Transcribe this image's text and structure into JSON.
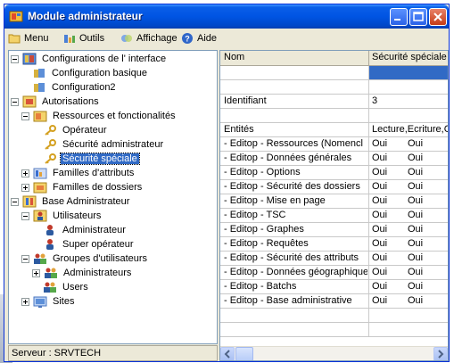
{
  "window": {
    "title": "Module administrateur"
  },
  "menu": [
    {
      "label": "Menu",
      "icon": "folder-icon"
    },
    {
      "label": "Outils",
      "icon": "tools-icon"
    },
    {
      "label": "Affichage",
      "icon": "display-icon"
    },
    {
      "label": "Aide",
      "icon": "help-icon"
    }
  ],
  "tree": [
    {
      "label": "Configurations de l' interface"
    },
    {
      "label": "Configuration basique"
    },
    {
      "label": "Configuration2"
    },
    {
      "label": "Autorisations"
    },
    {
      "label": "Ressources et fonctionalités"
    },
    {
      "label": "Opérateur"
    },
    {
      "label": "Sécurité administrateur"
    },
    {
      "label": "Sécurité spéciale"
    },
    {
      "label": "Familles d'attributs"
    },
    {
      "label": "Familles de dossiers"
    },
    {
      "label": "Base Administrateur"
    },
    {
      "label": "Utilisateurs"
    },
    {
      "label": "Administrateur"
    },
    {
      "label": "Super opérateur"
    },
    {
      "label": "Groupes d'utilisateurs"
    },
    {
      "label": "Administrateurs"
    },
    {
      "label": "Users"
    },
    {
      "label": "Sites"
    }
  ],
  "status": {
    "text": "Serveur : SRVTECH"
  },
  "grid": {
    "columns": [
      "Nom",
      "Sécurité spéciale"
    ],
    "rows": [
      {
        "c1": "",
        "c2": "",
        "c3": ""
      },
      {
        "c1": "Identifiant",
        "c2": "3",
        "c3": ""
      },
      {
        "c1": "",
        "c2": "",
        "c3": ""
      },
      {
        "c1": "Entités",
        "c2": "Lecture,Ecriture,Cr",
        "c3": ""
      },
      {
        "c1": " - Editop - Ressources (Nomencl",
        "c2": "Oui",
        "c3": "Oui"
      },
      {
        "c1": " - Editop - Données générales",
        "c2": "Oui",
        "c3": "Oui"
      },
      {
        "c1": " - Editop - Options",
        "c2": "Oui",
        "c3": "Oui"
      },
      {
        "c1": " - Editop - Sécurité des dossiers",
        "c2": "Oui",
        "c3": "Oui"
      },
      {
        "c1": " - Editop - Mise en page",
        "c2": "Oui",
        "c3": "Oui"
      },
      {
        "c1": " - Editop - TSC",
        "c2": "Oui",
        "c3": "Oui"
      },
      {
        "c1": " - Editop - Graphes",
        "c2": "Oui",
        "c3": "Oui"
      },
      {
        "c1": " - Editop - Requêtes",
        "c2": "Oui",
        "c3": "Oui"
      },
      {
        "c1": " - Editop - Sécurité des attributs",
        "c2": "Oui",
        "c3": "Oui"
      },
      {
        "c1": " - Editop - Données géographiques",
        "c2": "Oui",
        "c3": "Oui"
      },
      {
        "c1": " - Editop - Batchs",
        "c2": "Oui",
        "c3": "Oui"
      },
      {
        "c1": " - Editop - Base administrative",
        "c2": "Oui",
        "c3": "Oui"
      }
    ]
  }
}
